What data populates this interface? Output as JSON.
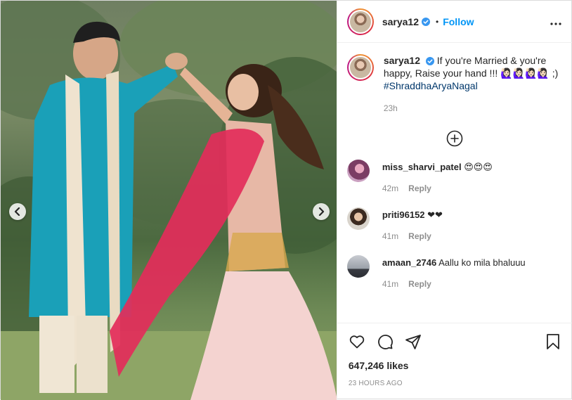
{
  "post": {
    "author": "sarya12",
    "follow_label": "Follow",
    "separator": "•"
  },
  "caption": {
    "username": "sarya12",
    "text": "If you're Married & you're happy, Raise your hand !!! 🙋🏻‍♀️🙋🏻‍♀️🙋🏻‍♀️🙋🏻‍♀️ ;)",
    "hashtag": "#ShraddhaAryaNagal",
    "time": "23h"
  },
  "comments": [
    {
      "username": "miss_sharvi_patel",
      "text": "😍😍😍",
      "time": "42m",
      "reply_label": "Reply"
    },
    {
      "username": "priti96152",
      "text": "❤❤",
      "time": "41m",
      "reply_label": "Reply"
    },
    {
      "username": "amaan_2746",
      "text": "Aallu ko mila bhaluuu",
      "time": "41m",
      "reply_label": "Reply"
    }
  ],
  "stats": {
    "likes": "647,246 likes",
    "posted": "23 HOURS AGO"
  },
  "icons": {
    "prev": "chevron-left-icon",
    "next": "chevron-right-icon",
    "verified": "verified-badge-icon",
    "more": "more-options-icon",
    "load_more": "plus-circle-icon",
    "like": "heart-icon",
    "comment": "comment-icon",
    "share": "share-icon",
    "save": "bookmark-icon"
  },
  "colors": {
    "accent": "#0095f6",
    "hashtag": "#00376b",
    "muted": "#8e8e8e",
    "border": "#dbdbdb"
  }
}
